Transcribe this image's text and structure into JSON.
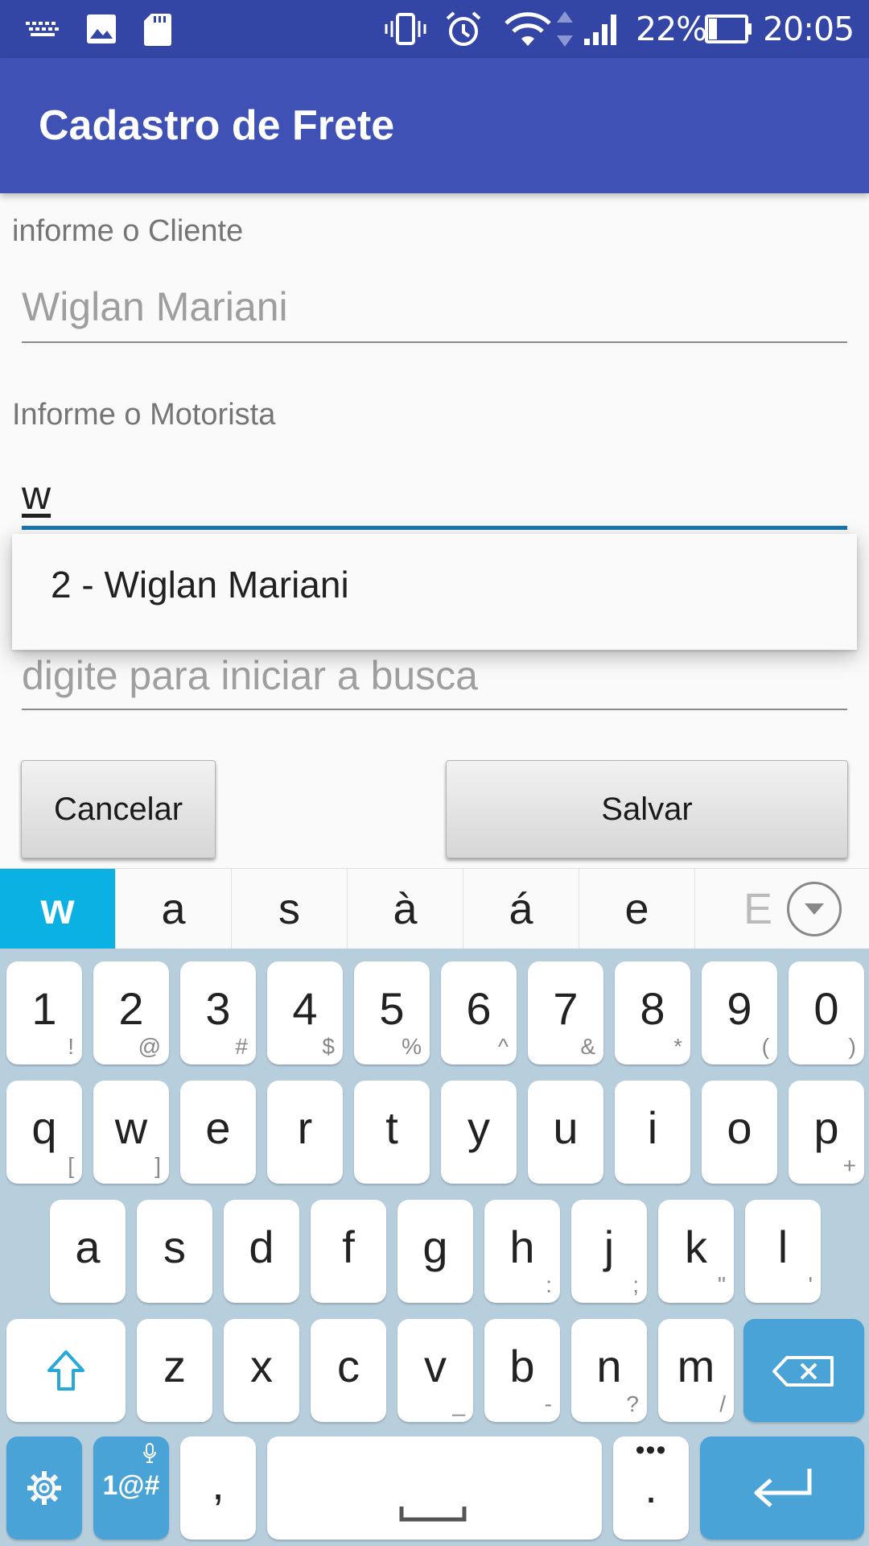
{
  "status_bar": {
    "battery": "22%",
    "time": "20:05",
    "icons": [
      "keyboard-icon",
      "image-icon",
      "sd-card-icon",
      "vibrate-icon",
      "alarm-icon",
      "wifi-icon",
      "data-arrows-icon",
      "signal-icon",
      "battery-icon"
    ]
  },
  "app_bar": {
    "title": "Cadastro de Frete"
  },
  "form": {
    "cliente": {
      "label": "informe o Cliente",
      "value": "Wiglan Mariani"
    },
    "motorista": {
      "label": "Informe o Motorista",
      "value": "w"
    },
    "third": {
      "placeholder": "digite para iniciar a busca"
    }
  },
  "dropdown": {
    "items": [
      "2 - Wiglan Mariani"
    ]
  },
  "buttons": {
    "cancel": "Cancelar",
    "save": "Salvar"
  },
  "suggestions": [
    "w",
    "a",
    "s",
    "à",
    "á",
    "e",
    "E"
  ],
  "keyboard": {
    "row1": [
      {
        "k": "1",
        "s": "!"
      },
      {
        "k": "2",
        "s": "@"
      },
      {
        "k": "3",
        "s": "#"
      },
      {
        "k": "4",
        "s": "$"
      },
      {
        "k": "5",
        "s": "%"
      },
      {
        "k": "6",
        "s": "^"
      },
      {
        "k": "7",
        "s": "&"
      },
      {
        "k": "8",
        "s": "*"
      },
      {
        "k": "9",
        "s": "("
      },
      {
        "k": "0",
        "s": ")"
      }
    ],
    "row2": [
      {
        "k": "q",
        "s": "["
      },
      {
        "k": "w",
        "s": "]"
      },
      {
        "k": "e",
        "s": ""
      },
      {
        "k": "r",
        "s": ""
      },
      {
        "k": "t",
        "s": ""
      },
      {
        "k": "y",
        "s": ""
      },
      {
        "k": "u",
        "s": ""
      },
      {
        "k": "i",
        "s": ""
      },
      {
        "k": "o",
        "s": ""
      },
      {
        "k": "p",
        "s": "+"
      }
    ],
    "row3": [
      {
        "k": "a",
        "s": ""
      },
      {
        "k": "s",
        "s": ""
      },
      {
        "k": "d",
        "s": ""
      },
      {
        "k": "f",
        "s": ""
      },
      {
        "k": "g",
        "s": ""
      },
      {
        "k": "h",
        "s": ":"
      },
      {
        "k": "j",
        "s": ";"
      },
      {
        "k": "k",
        "s": "\""
      },
      {
        "k": "l",
        "s": "'"
      }
    ],
    "row4": [
      {
        "k": "z",
        "s": ""
      },
      {
        "k": "x",
        "s": ""
      },
      {
        "k": "c",
        "s": ""
      },
      {
        "k": "v",
        "s": "_"
      },
      {
        "k": "b",
        "s": "-"
      },
      {
        "k": "n",
        "s": "?"
      },
      {
        "k": "m",
        "s": "/"
      }
    ],
    "symbols_label": "1@#",
    "comma": ",",
    "period": "."
  },
  "colors": {
    "status_bar": "#3446a5",
    "app_bar": "#3f51b5",
    "focus_line": "#1976b2",
    "suggestion_active": "#0bb1e3",
    "keyboard_bg": "#b7cedd",
    "function_key": "#4aa3d6"
  }
}
